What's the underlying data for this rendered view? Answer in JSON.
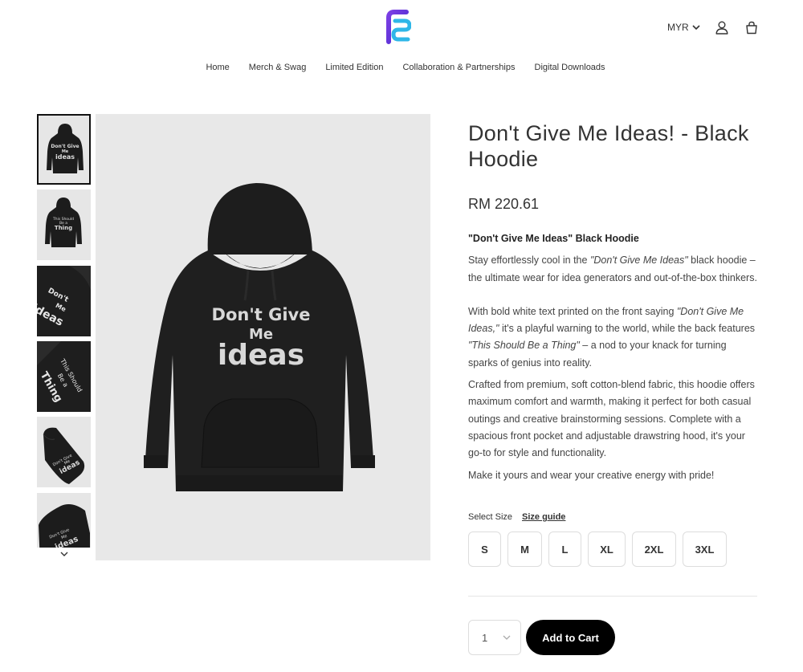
{
  "header": {
    "currency": "MYR"
  },
  "nav": [
    "Home",
    "Merch & Swag",
    "Limited Edition",
    "Collaboration & Partnerships",
    "Digital Downloads"
  ],
  "gallery": {
    "main_print": [
      "Don't Give",
      "Me",
      "ideas"
    ],
    "thumbnails": [
      {
        "lines": [
          "Don't Give",
          "Me",
          "ideas"
        ]
      },
      {
        "lines": [
          "This Should",
          "Be a",
          "Thing"
        ]
      },
      {
        "lines": [
          "Don't",
          "Me",
          "ideas"
        ]
      },
      {
        "lines": [
          "This Should",
          "Be a",
          "Thing"
        ]
      },
      {
        "lines": [
          "Don't Give",
          "Me",
          "ideas"
        ]
      },
      {
        "lines": [
          "Don't Give",
          "Me",
          "ideas"
        ]
      }
    ]
  },
  "product": {
    "title": "Don't Give Me Ideas! - Black Hoodie",
    "price": "RM 220.61",
    "desc_heading": "\"Don't Give Me Ideas\" Black Hoodie",
    "p1_a": "Stay effortlessly cool in the ",
    "p1_em": "\"Don't Give Me Ideas\"",
    "p1_b": " black hoodie – the ultimate wear for idea generators and out-of-the-box thinkers.",
    "p2_a": "With bold white text printed on the front saying ",
    "p2_em1": "\"Don't Give Me Ideas,\"",
    "p2_b": " it's a playful warning to the world, while the back features ",
    "p2_em2": "\"This Should Be a Thing\"",
    "p2_c": " – a nod to your knack for turning sparks of genius into reality.",
    "p3": "Crafted from premium, soft cotton-blend fabric, this hoodie offers maximum comfort and warmth, making it perfect for both casual outings and creative brainstorming sessions. Complete with a spacious front pocket and adjustable drawstring hood, it's your go-to for style and functionality.",
    "p4": "Make it yours and wear your creative energy with pride!"
  },
  "size_selector": {
    "label": "Select Size",
    "guide": "Size guide",
    "options": [
      "S",
      "M",
      "L",
      "XL",
      "2XL",
      "3XL"
    ]
  },
  "purchase": {
    "quantity": "1",
    "add_to_cart": "Add to Cart"
  }
}
